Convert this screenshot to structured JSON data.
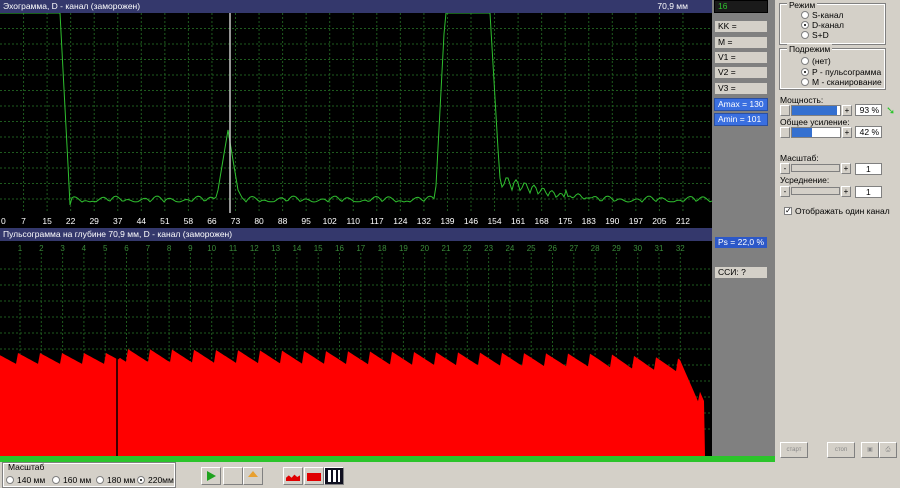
{
  "echo": {
    "title": "Эхограмма, D - канал (заморожен)",
    "depth": "70,9 мм",
    "x_ticks": [
      "0",
      "7",
      "15",
      "22",
      "29",
      "37",
      "44",
      "51",
      "58",
      "66",
      "73",
      "80",
      "88",
      "95",
      "102",
      "110",
      "117",
      "124",
      "132",
      "139",
      "146",
      "154",
      "161",
      "168",
      "175",
      "183",
      "190",
      "197",
      "205",
      "212"
    ]
  },
  "pulse": {
    "title": "Пульсограмма на глубине 70,9 мм, D - канал (заморожен)",
    "beat_labels": [
      "1",
      "2",
      "3",
      "4",
      "5",
      "6",
      "7",
      "8",
      "9",
      "10",
      "11",
      "12",
      "13",
      "14",
      "15",
      "16",
      "17",
      "18",
      "19",
      "20",
      "21",
      "22",
      "23",
      "24",
      "25",
      "26",
      "27",
      "28",
      "29",
      "30",
      "31",
      "32"
    ]
  },
  "indicators": {
    "top_value": "16",
    "kk": "KK =",
    "m": "M =",
    "v1": "V1 =",
    "v2": "V2 =",
    "v3": "V3 =",
    "amax": "Amax = 130",
    "amin": "Amin = 101",
    "ps": "Ps = 22,0 %",
    "ssi": "ССИ: ?"
  },
  "panel": {
    "mode_title": "Режим",
    "mode_options": [
      "S-канал",
      "D-канал",
      "S+D"
    ],
    "mode_selected": 1,
    "submode_title": "Подрежим",
    "submode_options": [
      "(нет)",
      "P - пульсограмма",
      "M - сканирование"
    ],
    "submode_selected": 1,
    "power_label": "Мощность:",
    "power_value": "93 %",
    "power_fraction": 0.93,
    "gain_label": "Общее усиление:",
    "gain_value": "42 %",
    "gain_fraction": 0.42,
    "scale_label": "Масштаб:",
    "scale_value": "1",
    "avg_label": "Усреднение:",
    "avg_value": "1",
    "single_channel": "Отображать один канал",
    "start_label": "старт",
    "stop_label": "стоп"
  },
  "bottom": {
    "scale_title": "Масштаб",
    "scale_options": [
      "140 мм",
      "160 мм",
      "180 мм",
      "220мм"
    ],
    "scale_selected": 3
  },
  "colors": {
    "trace": "#2fbf2f",
    "pulse": "#ff0000",
    "title_bg": "#34386c",
    "grid": "#1e5a1e"
  }
}
